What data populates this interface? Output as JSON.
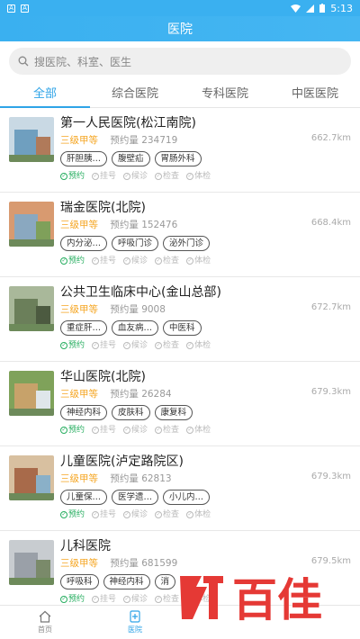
{
  "status": {
    "time": "5:13"
  },
  "header": {
    "title": "医院"
  },
  "search": {
    "placeholder": "搜医院、科室、医生"
  },
  "tabs": [
    {
      "label": "全部"
    },
    {
      "label": "综合医院"
    },
    {
      "label": "专科医院"
    },
    {
      "label": "中医医院"
    }
  ],
  "hospitals": [
    {
      "name": "第一人民医院(松江南院)",
      "level": "三级甲等",
      "booking_label": "预约量",
      "booking": "234719",
      "distance": "662.7km",
      "tags": [
        "肝胆胰…",
        "腹壁疝",
        "胃肠外科"
      ]
    },
    {
      "name": "瑞金医院(北院)",
      "level": "三级甲等",
      "booking_label": "预约量",
      "booking": "152476",
      "distance": "668.4km",
      "tags": [
        "内分泌…",
        "呼吸门诊",
        "泌外门诊"
      ]
    },
    {
      "name": "公共卫生临床中心(金山总部)",
      "level": "三级甲等",
      "booking_label": "预约量",
      "booking": "9008",
      "distance": "672.7km",
      "tags": [
        "重症肝…",
        "血友病…",
        "中医科"
      ]
    },
    {
      "name": "华山医院(北院)",
      "level": "三级甲等",
      "booking_label": "预约量",
      "booking": "26284",
      "distance": "679.3km",
      "tags": [
        "神经内科",
        "皮肤科",
        "康复科"
      ]
    },
    {
      "name": "儿童医院(泸定路院区)",
      "level": "三级甲等",
      "booking_label": "预约量",
      "booking": "62813",
      "distance": "679.3km",
      "tags": [
        "儿童保…",
        "医学遗…",
        "小儿内…"
      ]
    },
    {
      "name": "儿科医院",
      "level": "三级甲等",
      "booking_label": "预约量",
      "booking": "681599",
      "distance": "679.5km",
      "tags": [
        "呼吸科",
        "神经内科",
        "消"
      ]
    }
  ],
  "services": [
    "预约",
    "挂号",
    "候诊",
    "检查",
    "体检"
  ],
  "bottom_nav": [
    {
      "label": "首页"
    },
    {
      "label": "医院"
    }
  ],
  "watermark": {
    "text": "百佳"
  },
  "colors": {
    "primary": "#2fa4e7",
    "header": "#3ab0f0",
    "level": "#f5a623",
    "service_on": "#27ae60",
    "watermark": "#e53935"
  }
}
